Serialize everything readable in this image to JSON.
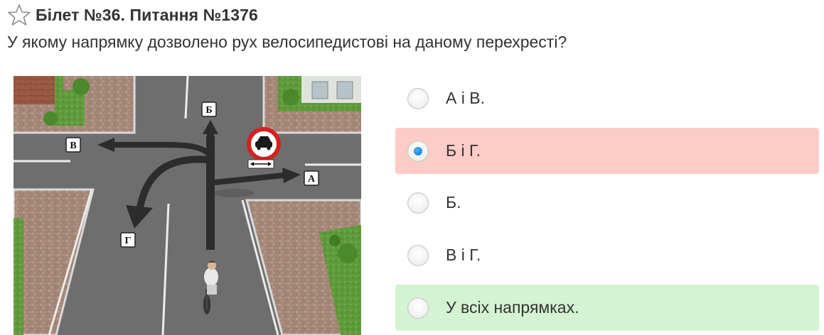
{
  "header": {
    "title": "Білет №36. Питання №1376"
  },
  "question": {
    "text": "У якому напрямку дозволено рух велосипедистові на даному перехресті?"
  },
  "scene": {
    "labels": {
      "a": "А",
      "b": "Б",
      "v": "В",
      "g": "Г"
    },
    "sign_icon": "no-motor-vehicles-sign",
    "sign_plate_icon": "double-arrow-icon"
  },
  "answers": [
    {
      "label": "А і В.",
      "selected": false,
      "state": "none"
    },
    {
      "label": "Б і Г.",
      "selected": true,
      "state": "wrong"
    },
    {
      "label": "Б.",
      "selected": false,
      "state": "none"
    },
    {
      "label": "В і Г.",
      "selected": false,
      "state": "none"
    },
    {
      "label": "У всіх напрямках.",
      "selected": false,
      "state": "correct"
    }
  ],
  "colors": {
    "wrong_bg": "#fdccc7",
    "correct_bg": "#d4f3d1",
    "radio_checked": "#1684e6"
  }
}
